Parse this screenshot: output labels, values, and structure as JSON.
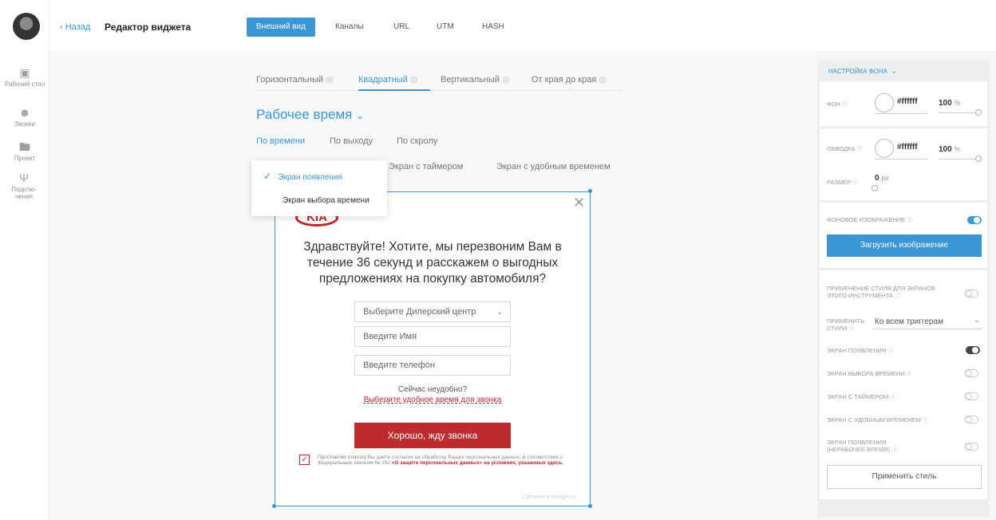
{
  "sidebar": {
    "items": [
      {
        "label": "Рабочий стол",
        "icon": "laptop-icon"
      },
      {
        "label": "Звонки",
        "icon": "user-icon"
      },
      {
        "label": "Проект",
        "icon": "folder-icon"
      },
      {
        "label": "Подклю-чения",
        "icon": "antenna-icon"
      }
    ]
  },
  "header": {
    "back_label": "Назад",
    "title": "Редактор виджета",
    "tabs": [
      "Внешний вид",
      "Каналы",
      "URL",
      "UTM",
      "HASH"
    ],
    "active_tab": "Внешний вид"
  },
  "format_tabs": [
    "Горизонтальный",
    "Квадратный",
    "Вертикальный",
    "От края до края"
  ],
  "active_format": "Квадратный",
  "mode_title": "Рабочее время",
  "sub_tabs": [
    "По времени",
    "По выходу",
    "По скролу"
  ],
  "screen_tabs": [
    "Экран с таймером",
    "Экран с удобным временем"
  ],
  "dropdown": {
    "items": [
      "Экран появления",
      "Экран выбора времени"
    ],
    "selected": "Экран появления"
  },
  "widget": {
    "logo": "KIA",
    "heading": "Здравствуйте! Хотите, мы перезвоним Вам в течение 36 секунд и расскажем о выгодных предложениях на покупку автомобиля?",
    "dealer_placeholder": "Выберите Дилерский центр",
    "name_placeholder": "Введите Имя",
    "phone_placeholder": "Введите телефон",
    "busy_text": "Сейчас неудобно?",
    "pick_time_link": "Выберите удобное время для звонка",
    "cta": "Хорошо, жду звонка",
    "consent_text": "Проставляя отметку Вы даете согласие на обработку Ваших персональных данных, в соответствии с Федеральным законом № 152",
    "consent_law": "«О защите персональных данных»",
    "consent_tail": "на условиях, указанных здесь.",
    "made_by": "Сделано в komget.ru"
  },
  "settings": {
    "section_title": "НАСТРОЙКА ФОНА",
    "bg_label": "ФОН",
    "bg_color": "#ffffff",
    "bg_opacity": "100",
    "border_label": "ОБВОДКА",
    "border_color": "#ffffff",
    "border_opacity": "100",
    "size_label": "РАЗМЕР",
    "size_value": "0",
    "size_unit": "px",
    "percent": "%",
    "bg_image_label": "ФОНОВОЕ ИЗОБРАЖЕНИЕ",
    "upload_label": "Загрузить изображение",
    "apply_style_label": "ПРИМЕНЕНИЕ СТИЛЯ ДЛЯ ЭКРАНОВ ЭТОГО ИНСТРУМЕНТА",
    "apply_styles_label": "ПРИМЕНИТЬ СТИЛИ",
    "apply_styles_value": "Ко всем триггерам",
    "screens": [
      {
        "label": "ЭКРАН ПОЯВЛЕНИЯ",
        "on": true
      },
      {
        "label": "ЭКРАН ВЫБОРА ВРЕМЕНИ",
        "on": false
      },
      {
        "label": "ЭКРАН С ТАЙМЕРОМ",
        "on": false
      },
      {
        "label": "ЭКРАН С УДОБНЫМ ВРЕМЕНЕМ",
        "on": false
      },
      {
        "label": "ЭКРАН ПОЯВЛЕНИЯ (НЕРАБОЧЕЕ ВРЕМЯ)",
        "on": false
      }
    ],
    "apply_button": "Применить стиль",
    "accent": "#3b96d6",
    "brand_red": "#be2b2f"
  }
}
